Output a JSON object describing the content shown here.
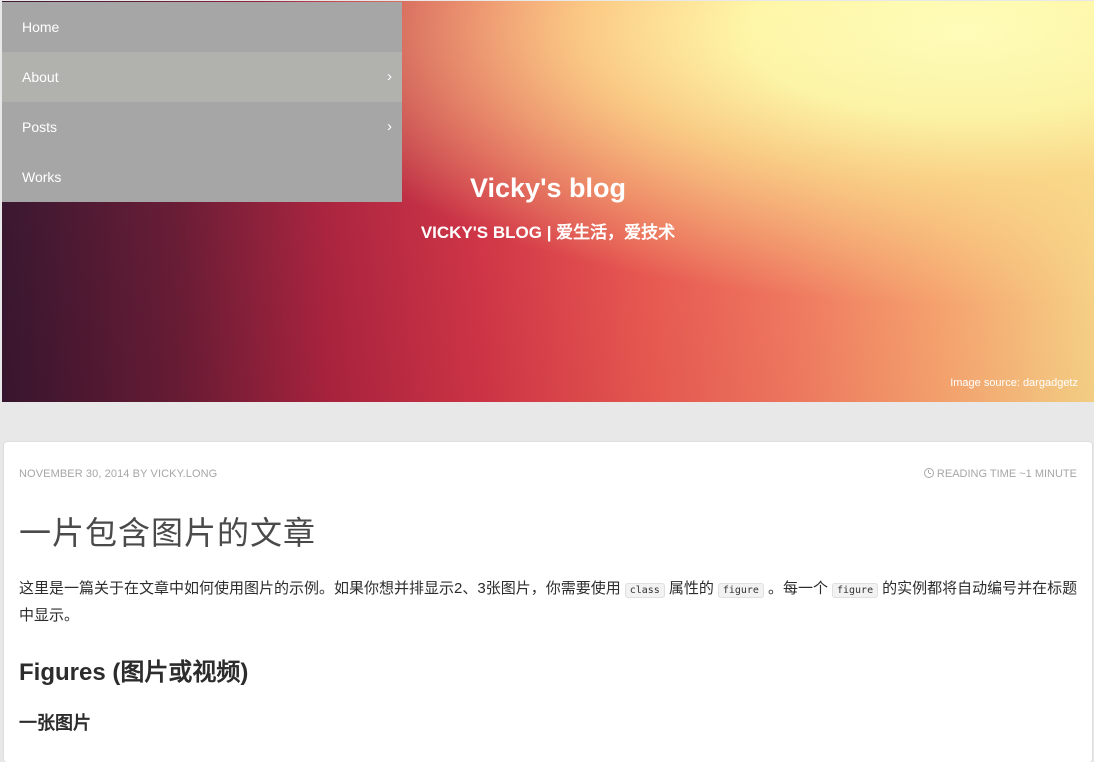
{
  "nav": {
    "items": [
      {
        "label": "Home",
        "has_submenu": false
      },
      {
        "label": "About",
        "has_submenu": true
      },
      {
        "label": "Posts",
        "has_submenu": true
      },
      {
        "label": "Works",
        "has_submenu": false
      }
    ],
    "arrow_glyph": "›"
  },
  "header": {
    "title": "Vicky's blog",
    "subtitle": "VICKY'S BLOG | 爱生活，爱技术",
    "image_source": "Image source: dargadgetz"
  },
  "post": {
    "date_author": "NOVEMBER 30, 2014 BY VICKY.LONG",
    "reading_time": "READING TIME ~1 MINUTE",
    "title": "一片包含图片的文章",
    "intro_part1": "这里是一篇关于在文章中如何使用图片的示例。如果你想并排显示2、3张图片，你需要使用",
    "code_class": "class",
    "intro_part2": "属性的",
    "code_figure_1": "figure",
    "intro_part3": "。每一个",
    "code_figure_2": "figure",
    "intro_part4": "的实例都将自动编号并在标题中显示。",
    "h2": "Figures (图片或视频)",
    "h3": "一张图片"
  },
  "colors": {
    "nav_bg": "#a6a6a6",
    "nav_active_bg": "#b1b1ad",
    "meta_text": "#a6a6a6",
    "page_bg": "#e8e8e8"
  },
  "icons": {
    "submenu": "chevron-right-icon",
    "reading_time": "clock-icon"
  }
}
